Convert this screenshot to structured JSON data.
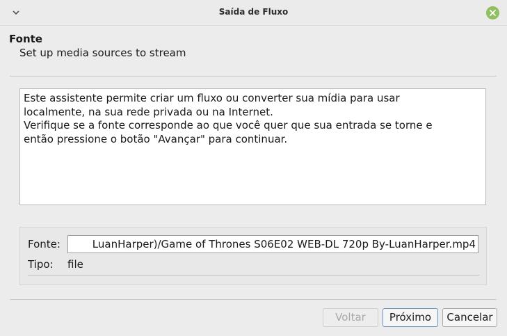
{
  "window": {
    "title": "Saída de Fluxo"
  },
  "icons": {
    "menu": "chevron-down-icon",
    "close": "close-icon",
    "close_color": "#8fbf5f"
  },
  "header": {
    "title": "Fonte",
    "subtitle": "Set up media sources to stream"
  },
  "description": {
    "line1": "Este assistente permite criar um fluxo ou converter sua mídia para usar",
    "line2": "localmente, na sua rede privada ou na Internet.",
    "line3": "Verifique se a fonte corresponde ao que você quer que sua entrada se torne e",
    "line4": "então pressione o botão \"Avançar\" para continuar."
  },
  "source": {
    "label": "Fonte:",
    "value": "LuanHarper)/Game of Thrones S06E02 WEB-DL 720p By-LuanHarper.mp4",
    "type_label": "Tipo:",
    "type_value": "file"
  },
  "buttons": {
    "back": "Voltar",
    "next": "Próximo",
    "cancel": "Cancelar"
  }
}
